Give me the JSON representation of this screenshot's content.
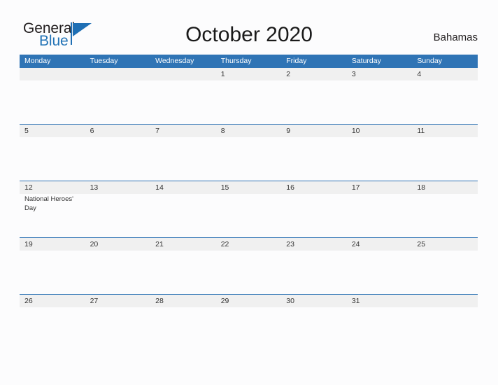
{
  "brand": {
    "name_part1": "General",
    "name_part2": "Blue",
    "logo_icon": "flag-triangle-icon"
  },
  "header": {
    "title": "October 2020",
    "country": "Bahamas"
  },
  "calendar": {
    "month": "October",
    "year": "2020",
    "weekday_headers": [
      "Monday",
      "Tuesday",
      "Wednesday",
      "Thursday",
      "Friday",
      "Saturday",
      "Sunday"
    ],
    "weeks": [
      [
        {
          "num": "",
          "event": ""
        },
        {
          "num": "",
          "event": ""
        },
        {
          "num": "",
          "event": ""
        },
        {
          "num": "1",
          "event": ""
        },
        {
          "num": "2",
          "event": ""
        },
        {
          "num": "3",
          "event": ""
        },
        {
          "num": "4",
          "event": ""
        }
      ],
      [
        {
          "num": "5",
          "event": ""
        },
        {
          "num": "6",
          "event": ""
        },
        {
          "num": "7",
          "event": ""
        },
        {
          "num": "8",
          "event": ""
        },
        {
          "num": "9",
          "event": ""
        },
        {
          "num": "10",
          "event": ""
        },
        {
          "num": "11",
          "event": ""
        }
      ],
      [
        {
          "num": "12",
          "event": "National Heroes' Day"
        },
        {
          "num": "13",
          "event": ""
        },
        {
          "num": "14",
          "event": ""
        },
        {
          "num": "15",
          "event": ""
        },
        {
          "num": "16",
          "event": ""
        },
        {
          "num": "17",
          "event": ""
        },
        {
          "num": "18",
          "event": ""
        }
      ],
      [
        {
          "num": "19",
          "event": ""
        },
        {
          "num": "20",
          "event": ""
        },
        {
          "num": "21",
          "event": ""
        },
        {
          "num": "22",
          "event": ""
        },
        {
          "num": "23",
          "event": ""
        },
        {
          "num": "24",
          "event": ""
        },
        {
          "num": "25",
          "event": ""
        }
      ],
      [
        {
          "num": "26",
          "event": ""
        },
        {
          "num": "27",
          "event": ""
        },
        {
          "num": "28",
          "event": ""
        },
        {
          "num": "29",
          "event": ""
        },
        {
          "num": "30",
          "event": ""
        },
        {
          "num": "31",
          "event": ""
        },
        {
          "num": "",
          "event": ""
        }
      ]
    ]
  },
  "colors": {
    "header_blue": "#2f74b5",
    "brand_blue": "#2273b6",
    "band_gray": "#f0f0f0",
    "page_background": "#fcfcfd",
    "text_dark": "#333333"
  }
}
